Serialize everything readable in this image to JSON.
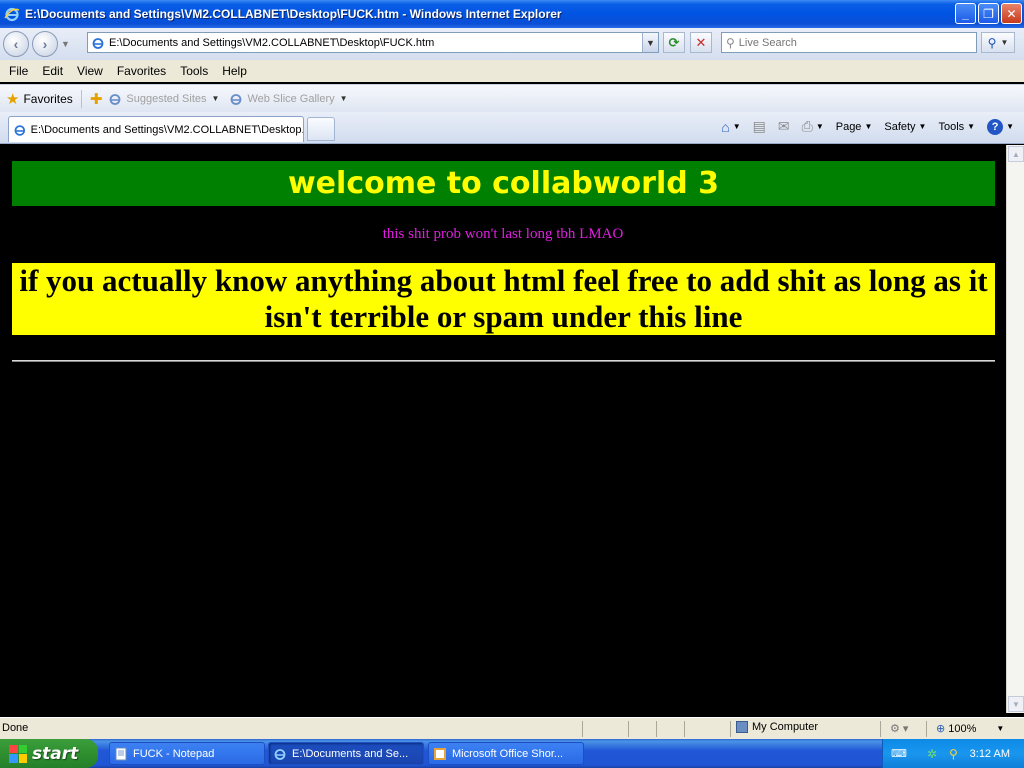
{
  "window": {
    "title": "E:\\Documents and Settings\\VM2.COLLABNET\\Desktop\\FUCK.htm - Windows Internet Explorer"
  },
  "address_bar": {
    "url": "E:\\Documents and Settings\\VM2.COLLABNET\\Desktop\\FUCK.htm",
    "search_placeholder": "Live Search"
  },
  "menu": [
    "File",
    "Edit",
    "View",
    "Favorites",
    "Tools",
    "Help"
  ],
  "favorites_bar": {
    "favorites_label": "Favorites",
    "links": [
      "Suggested Sites",
      "Web Slice Gallery"
    ]
  },
  "tabs": [
    {
      "label": "E:\\Documents and Settings\\VM2.COLLABNET\\Desktop..."
    }
  ],
  "command_bar": {
    "page_label": "Page",
    "safety_label": "Safety",
    "tools_label": "Tools"
  },
  "page": {
    "welcome": "welcome to collabworld 3",
    "subtitle": "this shit prob won't last long tbh LMAO",
    "notice": "if you actually know anything about html feel free to add shit as long as it isn't terrible or spam under this line",
    "colors": {
      "background": "#000000",
      "welcome_bg": "#008000",
      "welcome_text": "#ffff00",
      "subtitle_text": "#e020e0",
      "notice_bg": "#ffff00",
      "notice_text": "#000000"
    }
  },
  "status_bar": {
    "status": "Done",
    "zone": "My Computer",
    "zoom": "100%"
  },
  "taskbar": {
    "start_label": "start",
    "tasks": [
      {
        "label": "FUCK - Notepad"
      },
      {
        "label": "E:\\Documents and Se..."
      },
      {
        "label": "Microsoft Office Shor..."
      }
    ],
    "clock": "3:12 AM"
  }
}
